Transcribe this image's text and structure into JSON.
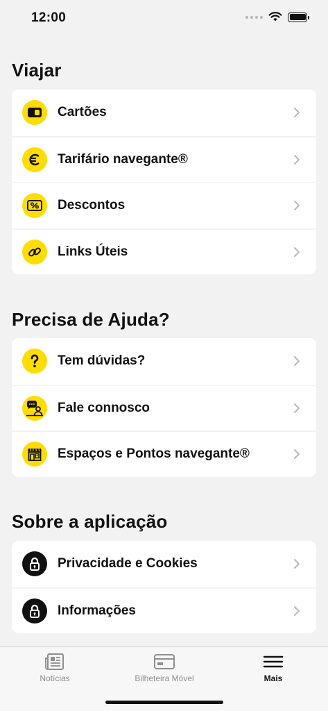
{
  "status": {
    "time": "12:00"
  },
  "sections": [
    {
      "title": "Viajar",
      "items": [
        {
          "label": "Cartões",
          "icon": "card-icon"
        },
        {
          "label": "Tarifário navegante®",
          "icon": "euro-icon"
        },
        {
          "label": "Descontos",
          "icon": "discount-icon"
        },
        {
          "label": "Links Úteis",
          "icon": "link-icon"
        }
      ]
    },
    {
      "title": "Precisa de Ajuda?",
      "items": [
        {
          "label": "Tem dúvidas?",
          "icon": "question-icon"
        },
        {
          "label": "Fale connosco",
          "icon": "chat-person-icon"
        },
        {
          "label": "Espaços e Pontos navegante®",
          "icon": "store-icon"
        }
      ]
    },
    {
      "title": "Sobre a aplicação",
      "items": [
        {
          "label": "Privacidade e Cookies",
          "icon": "lock-icon"
        },
        {
          "label": "Informações",
          "icon": "lock-icon"
        }
      ]
    }
  ],
  "tabs": [
    {
      "label": "Notícias",
      "icon": "newspaper-icon",
      "active": false
    },
    {
      "label": "Bilheteira Móvel",
      "icon": "ticket-card-icon",
      "active": false
    },
    {
      "label": "Mais",
      "icon": "menu-icon",
      "active": true
    }
  ],
  "colors": {
    "accent": "#ffdd00",
    "background": "#f2f2f2",
    "text": "#111111",
    "inactive": "#8e8e8e"
  }
}
